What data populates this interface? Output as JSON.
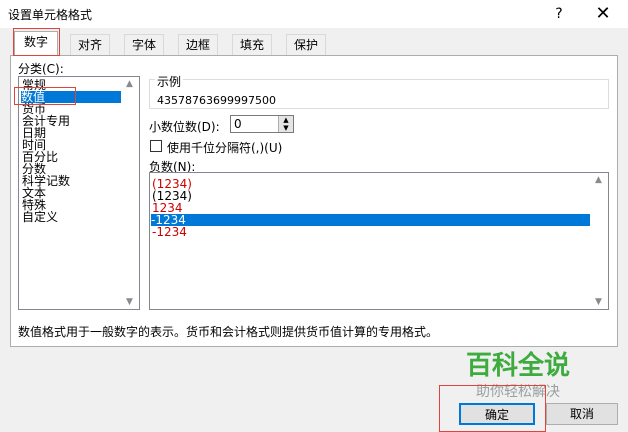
{
  "window": {
    "title": "设置单元格格式",
    "help": "?",
    "close": "✕"
  },
  "tabs": [
    {
      "label": "数字",
      "active": true
    },
    {
      "label": "对齐"
    },
    {
      "label": "字体"
    },
    {
      "label": "边框"
    },
    {
      "label": "填充"
    },
    {
      "label": "保护"
    }
  ],
  "category": {
    "label": "分类(C):",
    "items": [
      "常规",
      "数值",
      "货币",
      "会计专用",
      "日期",
      "时间",
      "百分比",
      "分数",
      "科学记数",
      "文本",
      "特殊",
      "自定义"
    ],
    "selected_index": 1
  },
  "sample": {
    "legend": "示例",
    "value": "43578763699997500"
  },
  "decimal": {
    "label": "小数位数(D):",
    "value": "0"
  },
  "thousands": {
    "label": "使用千位分隔符(,)(U)",
    "checked": false
  },
  "negative": {
    "label": "负数(N):",
    "items": [
      {
        "text": "(1234)",
        "color": "#cc0000"
      },
      {
        "text": "(1234)",
        "color": "#000000"
      },
      {
        "text": "1234",
        "color": "#cc0000"
      },
      {
        "text": "-1234",
        "color": "#000000"
      },
      {
        "text": "-1234",
        "color": "#cc0000"
      }
    ],
    "selected_index": 3
  },
  "description": "数值格式用于一般数字的表示。货币和会计格式则提供货币值计算的专用格式。",
  "buttons": {
    "ok": "确定",
    "cancel": "取消"
  },
  "watermark": {
    "title": "百科全说",
    "subtitle": "助你轻松解决"
  },
  "colors": {
    "accent": "#0078d7",
    "highlight": "#e0433c",
    "watermark": "#3dab3d"
  }
}
